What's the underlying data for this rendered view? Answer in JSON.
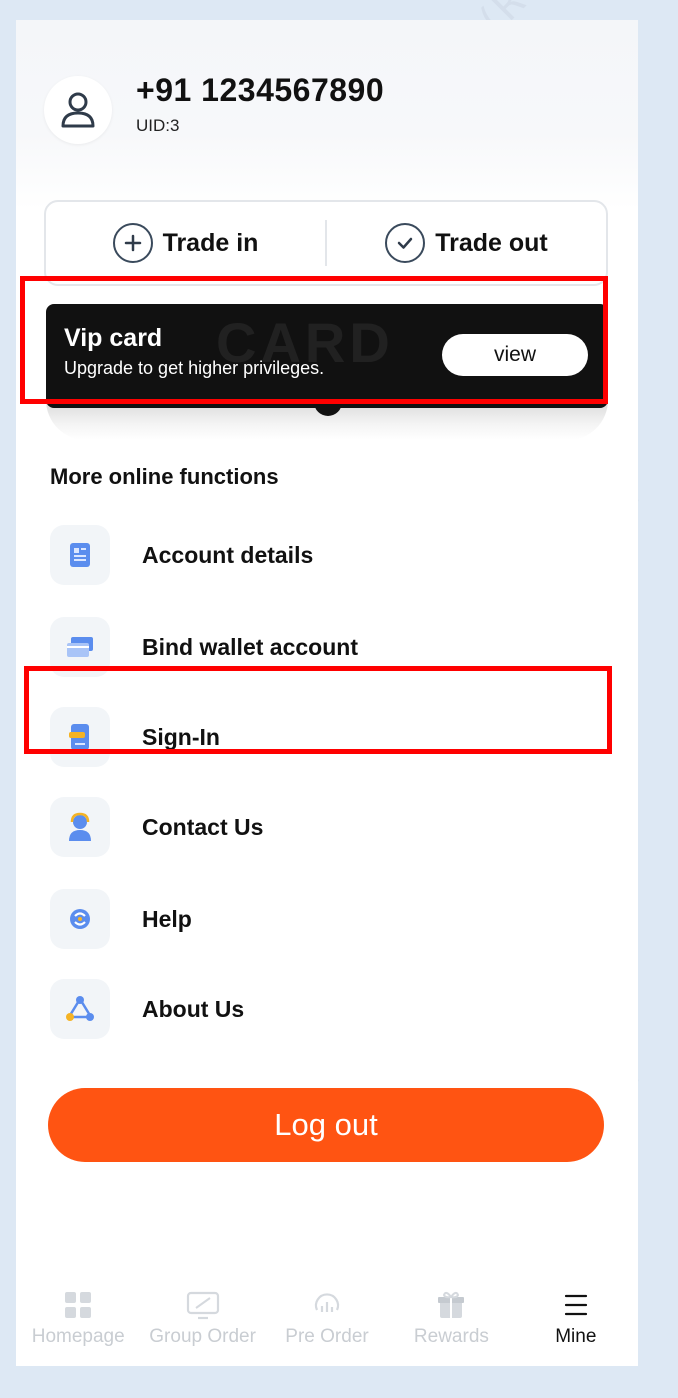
{
  "profile": {
    "phone": "+91 1234567890",
    "uid": "UID:3"
  },
  "trade": {
    "in_label": "Trade in",
    "out_label": "Trade out"
  },
  "vip": {
    "title": "Vip card",
    "subtitle": "Upgrade to get higher privileges.",
    "view_label": "view",
    "watermark": "CARD"
  },
  "section": {
    "title": "More online functions"
  },
  "menu": [
    {
      "label": "Account details",
      "icon": "account-details-icon"
    },
    {
      "label": "Bind wallet account",
      "icon": "wallet-card-icon"
    },
    {
      "label": "Sign-In",
      "icon": "sign-in-icon"
    },
    {
      "label": "Contact Us",
      "icon": "support-agent-icon"
    },
    {
      "label": "Help",
      "icon": "help-icon"
    },
    {
      "label": "About Us",
      "icon": "about-us-icon"
    }
  ],
  "logout_label": "Log out",
  "tabs": [
    {
      "label": "Homepage",
      "icon": "grid-icon",
      "active": false
    },
    {
      "label": "Group Order",
      "icon": "monitor-icon",
      "active": false
    },
    {
      "label": "Pre Order",
      "icon": "pre-order-icon",
      "active": false
    },
    {
      "label": "Rewards",
      "icon": "gift-icon",
      "active": false
    },
    {
      "label": "Mine",
      "icon": "menu-icon",
      "active": true
    }
  ],
  "watermark_lines": [
    "R001(R001)",
    "WIN001"
  ],
  "colors": {
    "accent": "#ff5412",
    "highlight": "#ff0000",
    "page_bg": "#dde8f4"
  }
}
